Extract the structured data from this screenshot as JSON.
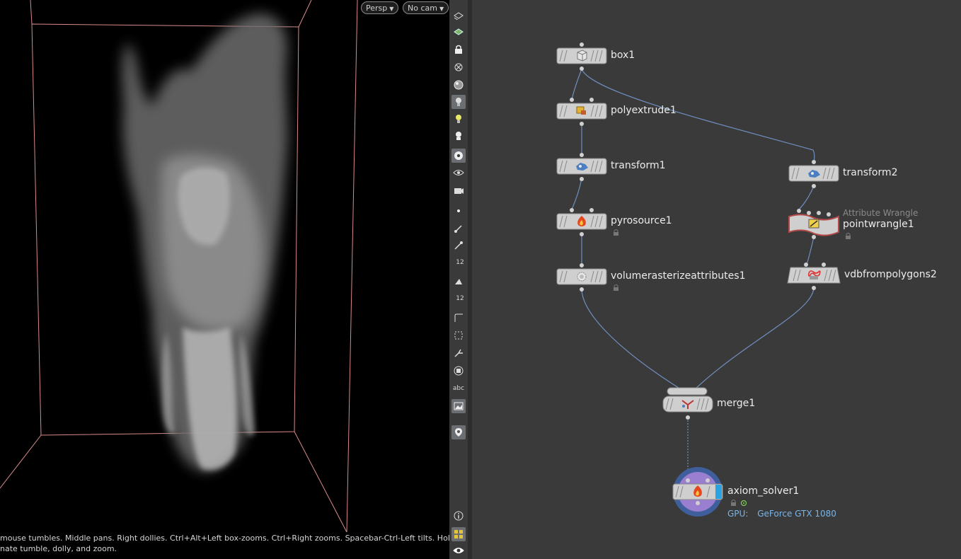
{
  "viewport": {
    "persp_button": "Persp",
    "camera_button": "No cam",
    "status_line1": "mouse tumbles. Middle pans. Right dollies. Ctrl+Alt+Left box-zooms. Ctrl+Right zooms. Spacebar-Ctrl-Left tilts. Hold L for",
    "status_line2": "nate tumble, dolly, and zoom."
  },
  "toolbar": {
    "text_tool": "abc",
    "num_tool_a": "12",
    "num_tool_b": "12"
  },
  "network": {
    "nodes": {
      "box1": "box1",
      "polyextrude1": "polyextrude1",
      "transform1": "transform1",
      "pyrosource1": "pyrosource1",
      "volumerasterizeattributes1": "volumerasterizeattributes1",
      "transform2": "transform2",
      "pointwrangle1": "pointwrangle1",
      "pointwrangle1_type": "Attribute Wrangle",
      "vdbfrompolygons2": "vdbfrompolygons2",
      "merge1": "merge1",
      "axiom_solver1": "axiom_solver1"
    },
    "gpu": {
      "label": "GPU:",
      "value": "GeForce GTX 1080"
    }
  }
}
